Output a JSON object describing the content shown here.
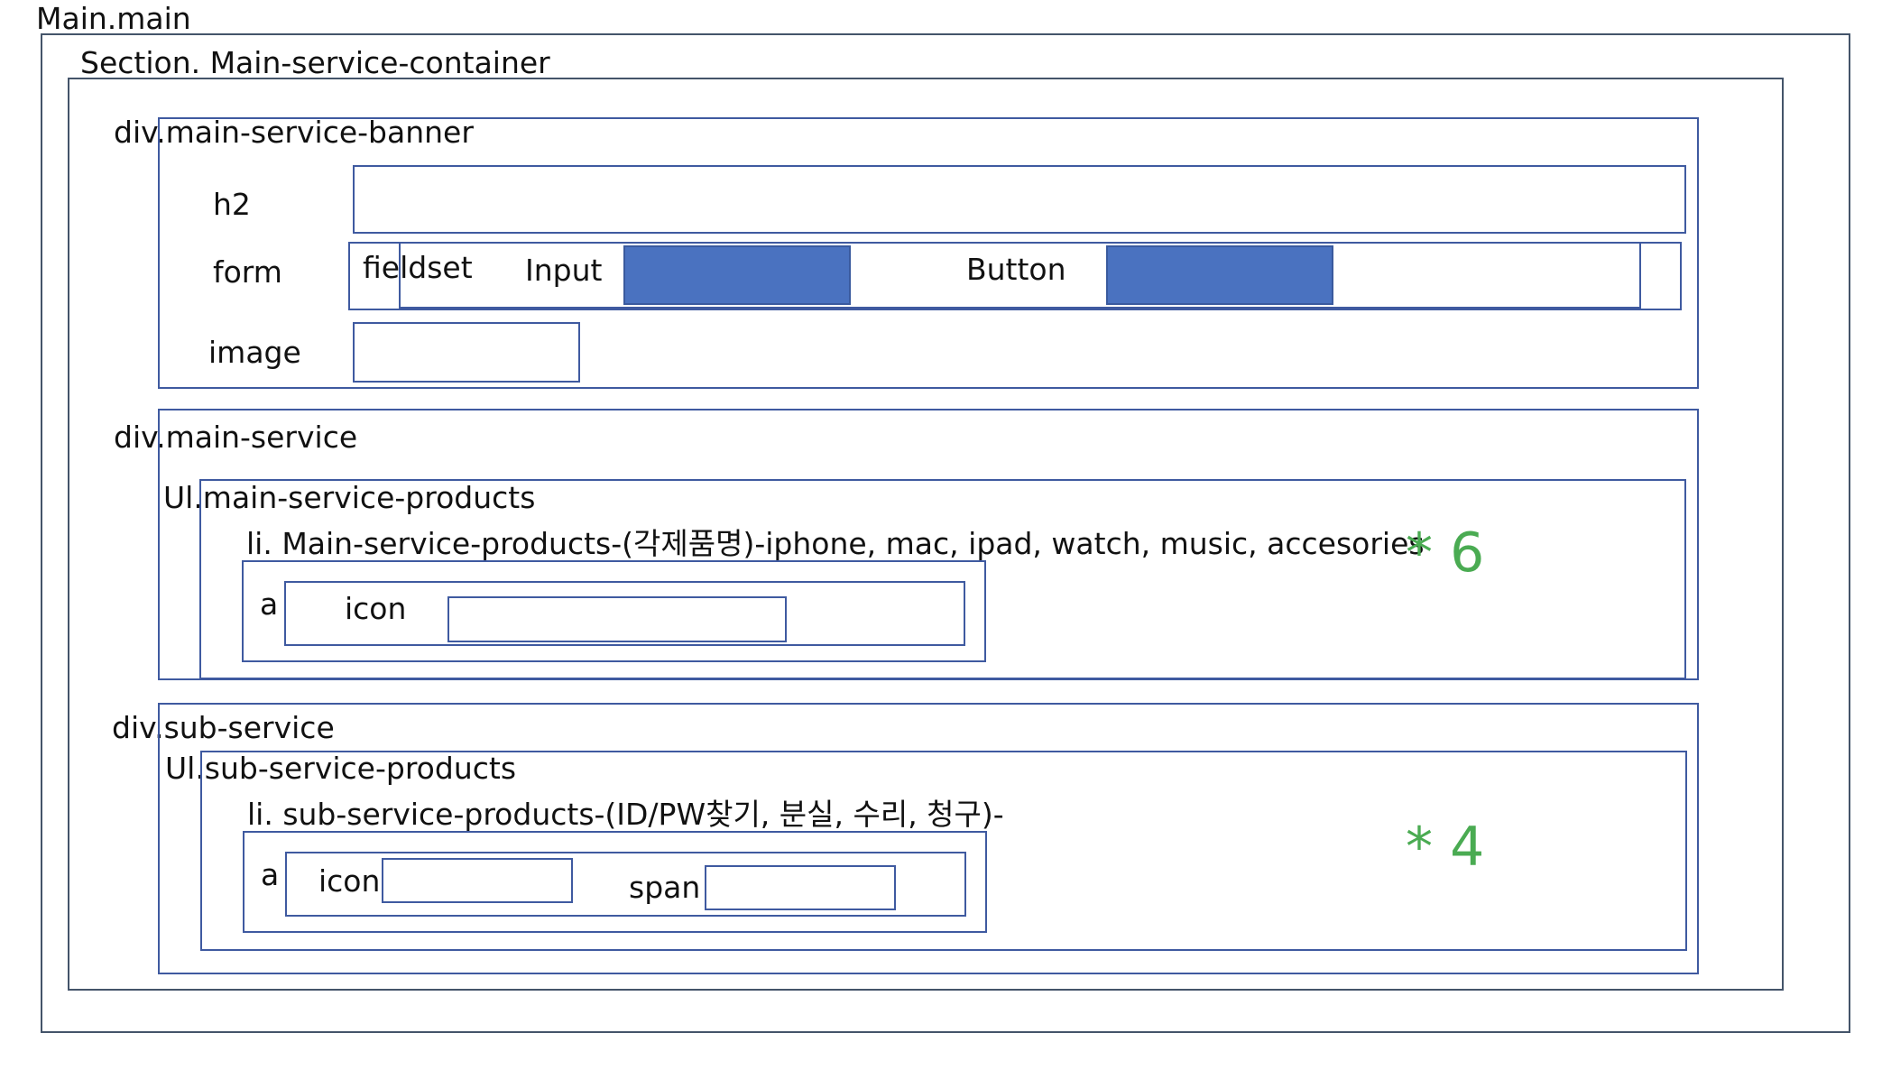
{
  "diagram": {
    "main": {
      "label": "Main.main"
    },
    "section": {
      "label": "Section. Main-service-container"
    },
    "banner": {
      "label": "div.main-service-banner",
      "h2_label": "h2",
      "form_label": "form",
      "fieldset_label": "fieldset",
      "input_label": "Input",
      "button_label": "Button",
      "image_label": "image"
    },
    "main_service": {
      "label": "div.main-service",
      "ul_label": "Ul.main-service-products",
      "li_label": "li. Main-service-products-(각제품명)-iphone, mac, ipad, watch, music, accesories",
      "a_label": "a",
      "icon_label": "icon",
      "multiplier": "* 6"
    },
    "sub_service": {
      "label": "div.sub-service",
      "ul_label": "Ul.sub-service-products",
      "li_label": "li. sub-service-products-(ID/PW찾기, 분실, 수리, 청구)-",
      "a_label": "a",
      "icon_label": "icon",
      "span_label": "span",
      "multiplier": "* 4"
    },
    "colors": {
      "border": "#44546a",
      "fill_block": "#4a72c0",
      "multiplier_text": "#4aab52"
    }
  }
}
